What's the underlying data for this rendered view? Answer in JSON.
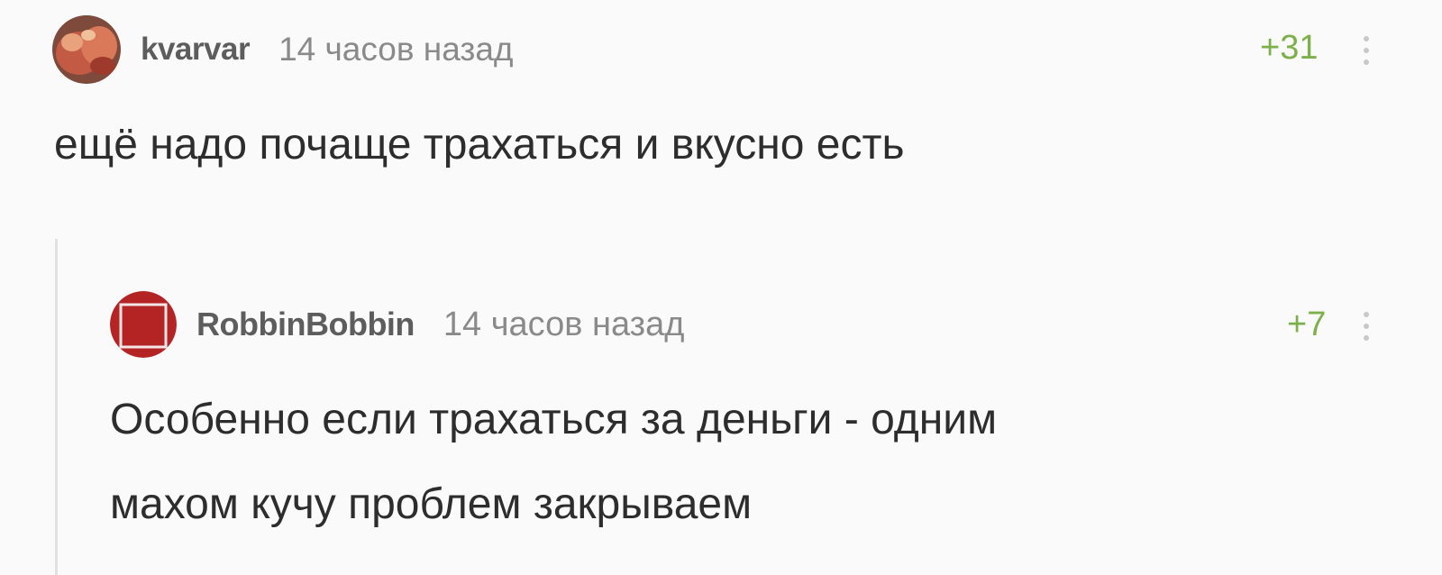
{
  "comments": [
    {
      "username": "kvarvar",
      "time": "14 часов назад",
      "rating": "+31",
      "text": "ещё надо почаще трахаться и вкусно есть",
      "avatar_color": "#b84a3c"
    },
    {
      "username": "RobbinBobbin",
      "time": "14 часов назад",
      "rating": "+7",
      "text_lines": [
        "Особенно если трахаться за деньги - одним",
        "махом кучу проблем закрываем"
      ],
      "avatar_color": "#b42424"
    }
  ],
  "colors": {
    "background": "#fbfafb",
    "rating_positive": "#7bb04a",
    "username": "#5d5d5d",
    "timestamp": "#8a8a8a",
    "text": "#2d2d2d",
    "thread_line": "#e1e1e1"
  }
}
